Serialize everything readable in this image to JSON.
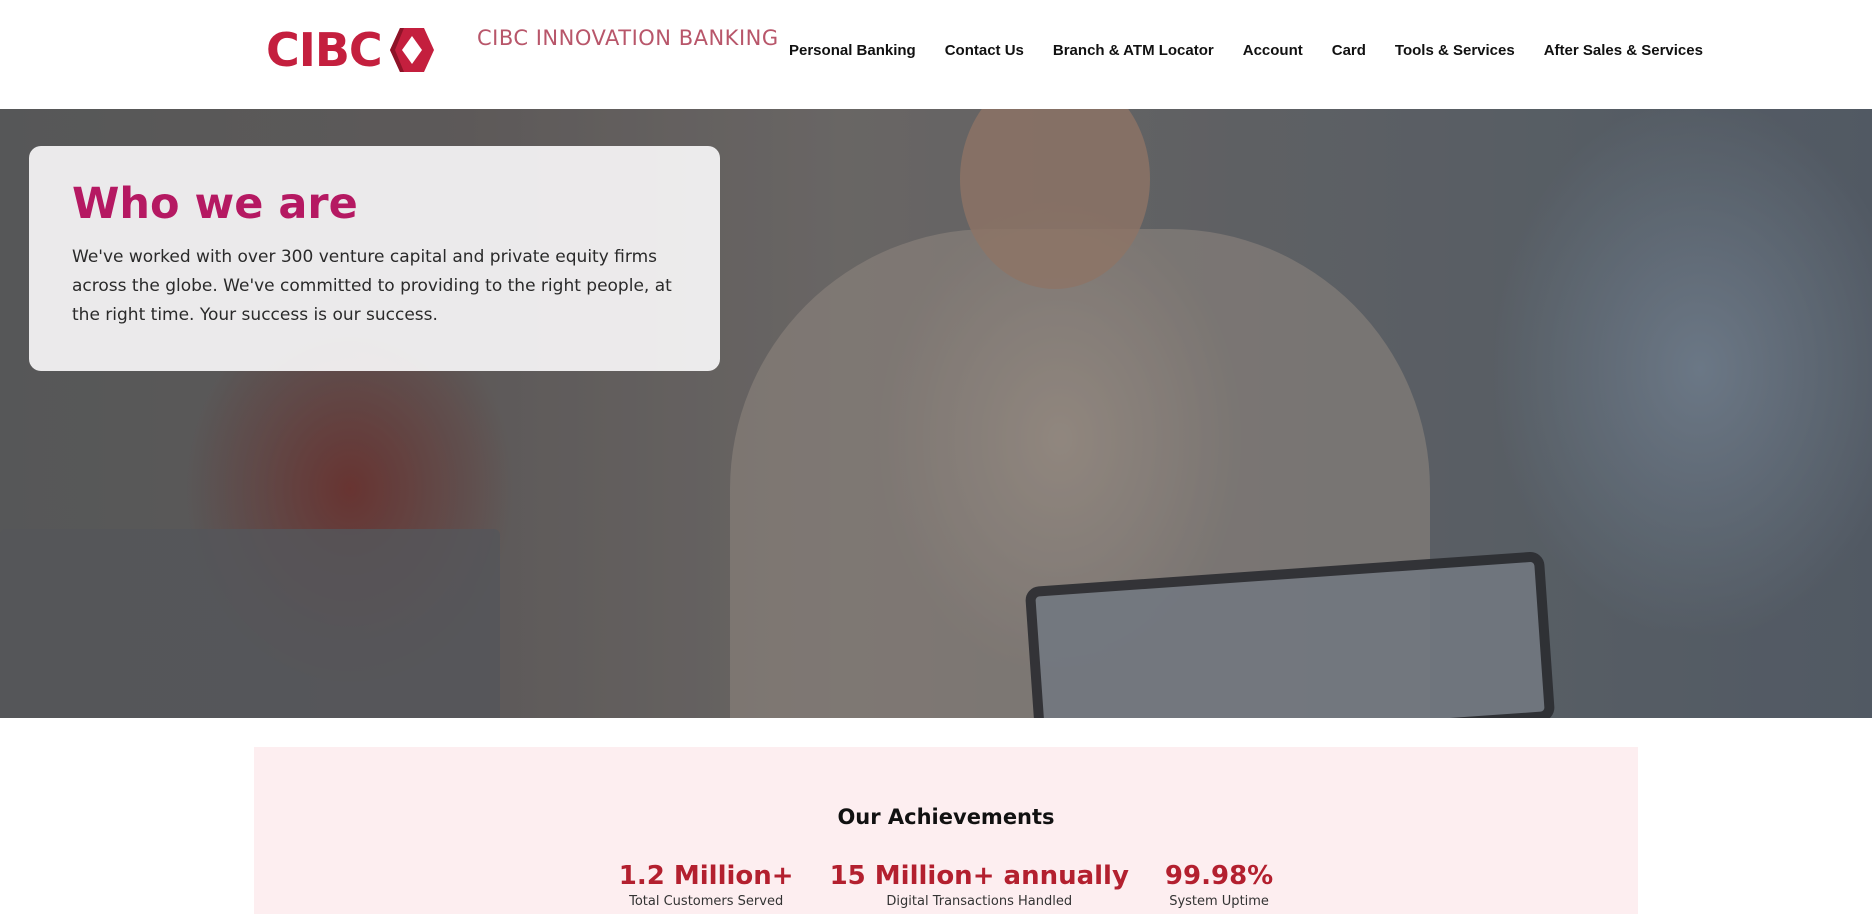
{
  "header": {
    "logo_text": "CIBC",
    "brand_sub": "CIBC INNOVATION BANKING",
    "nav": [
      {
        "label": "Personal Banking"
      },
      {
        "label": "Contact Us"
      },
      {
        "label": "Branch & ATM Locator"
      },
      {
        "label": "Account"
      },
      {
        "label": "Card"
      },
      {
        "label": "Tools & Services"
      },
      {
        "label": "After Sales & Services"
      }
    ]
  },
  "hero": {
    "title": "Who we are",
    "body": "We've worked with over 300 venture capital and private equity firms across the globe. We've committed to providing to the right people, at the right time. Your success is our success."
  },
  "achievements": {
    "title": "Our Achievements",
    "stats": [
      {
        "value": "1.2 Million+",
        "label": "Total Customers Served"
      },
      {
        "value": "15 Million+ annually",
        "label": "Digital Transactions Handled"
      },
      {
        "value": "99.98%",
        "label": "System Uptime"
      }
    ]
  },
  "colors": {
    "brand": "#c41f3e",
    "title_accent": "#b51962",
    "stat_accent": "#b3202f",
    "achievements_bg": "#fdeef0"
  }
}
